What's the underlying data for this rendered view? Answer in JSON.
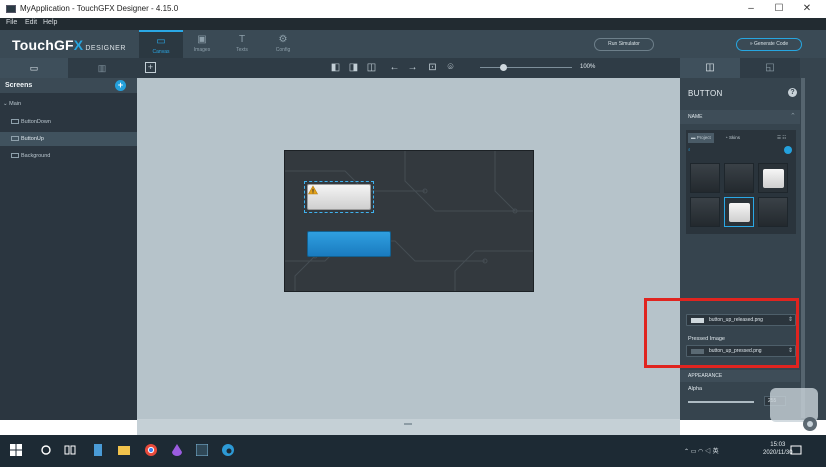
{
  "window": {
    "title": "MyApplication - TouchGFX Designer - 4.15.0",
    "minimize": "–",
    "maximize": "☐",
    "close": "✕"
  },
  "menu": [
    "File",
    "Edit",
    "Help"
  ],
  "header": {
    "logo_main": "TouchGF",
    "logo_x": "X",
    "logo_sub": "DESIGNER",
    "tabs": [
      {
        "label": "Canvas",
        "icon": "canvas-icon",
        "glyph": "▭"
      },
      {
        "label": "Images",
        "icon": "images-icon",
        "glyph": "▣"
      },
      {
        "label": "Texts",
        "icon": "texts-icon",
        "glyph": "T"
      },
      {
        "label": "Config",
        "icon": "config-icon",
        "glyph": "⚙"
      }
    ],
    "run_simulator": "Run Simulator",
    "generate_code": "» Generate Code"
  },
  "left_panel": {
    "tabs": [
      "▭",
      "▥"
    ],
    "screens_label": "Screens",
    "add_glyph": "+",
    "tree": [
      {
        "label": "Main",
        "level": 0
      },
      {
        "label": "ButtonDown",
        "level": 1
      },
      {
        "label": "ButtonUp",
        "level": 1
      },
      {
        "label": "Background",
        "level": 1
      }
    ]
  },
  "toolbar": {
    "add_glyph": "+",
    "zoom_label": "100%"
  },
  "right_panel": {
    "tabs": [
      "◫",
      "◱"
    ],
    "title": "BUTTON",
    "help_glyph": "?",
    "name_section": "NAME",
    "image_tabs": [
      "Project",
      "Skins"
    ],
    "image_search": "",
    "released_image": "button_up_released.png",
    "pressed_label": "Pressed Image",
    "pressed_image": "button_up_pressed.png",
    "appearance_section": "APPEARANCE",
    "alpha_label": "Alpha",
    "alpha_value": "255"
  },
  "taskbar": {
    "time": "15:03",
    "date": "2020/11/30",
    "ime": "英"
  },
  "colors": {
    "accent": "#27a6e0",
    "highlight": "#e0241f",
    "button_down": "#1e88cf"
  }
}
